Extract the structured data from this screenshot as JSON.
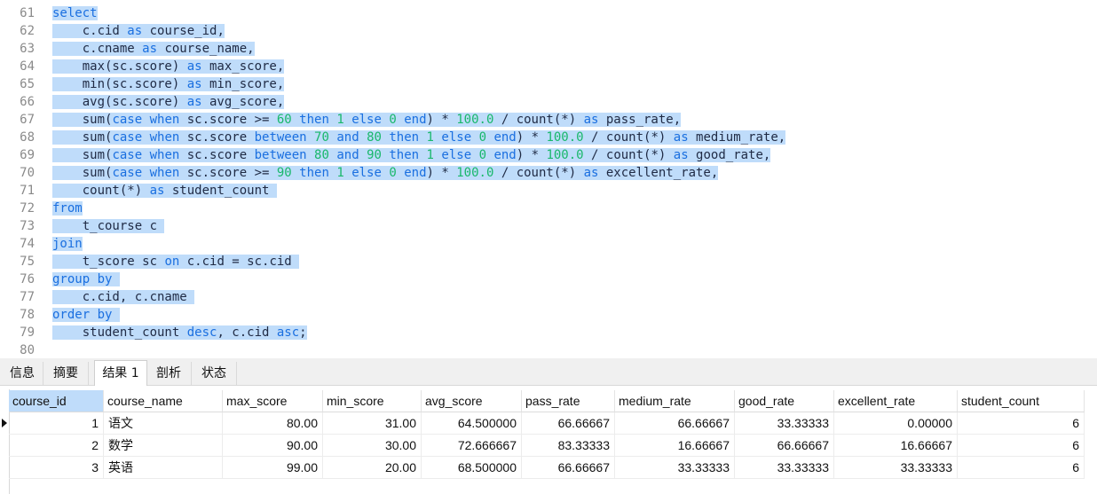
{
  "editor": {
    "lines": [
      {
        "no": "61",
        "segs": [
          {
            "t": "select",
            "c": "kw"
          }
        ]
      },
      {
        "no": "62",
        "segs": [
          {
            "t": "    c.cid "
          },
          {
            "t": "as",
            "c": "kw"
          },
          {
            "t": " course_id,"
          }
        ]
      },
      {
        "no": "63",
        "segs": [
          {
            "t": "    c.cname "
          },
          {
            "t": "as",
            "c": "kw"
          },
          {
            "t": " course_name,"
          }
        ]
      },
      {
        "no": "64",
        "segs": [
          {
            "t": "    max(sc.score) "
          },
          {
            "t": "as",
            "c": "kw"
          },
          {
            "t": " max_score,"
          }
        ]
      },
      {
        "no": "65",
        "segs": [
          {
            "t": "    min(sc.score) "
          },
          {
            "t": "as",
            "c": "kw"
          },
          {
            "t": " min_score,"
          }
        ]
      },
      {
        "no": "66",
        "segs": [
          {
            "t": "    avg(sc.score) "
          },
          {
            "t": "as",
            "c": "kw"
          },
          {
            "t": " avg_score,"
          }
        ]
      },
      {
        "no": "67",
        "segs": [
          {
            "t": "    sum("
          },
          {
            "t": "case when",
            "c": "kw"
          },
          {
            "t": " sc.score >= "
          },
          {
            "t": "60",
            "c": "num"
          },
          {
            "t": " "
          },
          {
            "t": "then",
            "c": "kw"
          },
          {
            "t": " "
          },
          {
            "t": "1",
            "c": "num"
          },
          {
            "t": " "
          },
          {
            "t": "else",
            "c": "kw"
          },
          {
            "t": " "
          },
          {
            "t": "0",
            "c": "num"
          },
          {
            "t": " "
          },
          {
            "t": "end",
            "c": "kw"
          },
          {
            "t": ") * "
          },
          {
            "t": "100.0",
            "c": "num"
          },
          {
            "t": " / count(*) "
          },
          {
            "t": "as",
            "c": "kw"
          },
          {
            "t": " pass_rate,"
          }
        ]
      },
      {
        "no": "68",
        "segs": [
          {
            "t": "    sum("
          },
          {
            "t": "case when",
            "c": "kw"
          },
          {
            "t": " sc.score "
          },
          {
            "t": "between",
            "c": "kw"
          },
          {
            "t": " "
          },
          {
            "t": "70",
            "c": "num"
          },
          {
            "t": " "
          },
          {
            "t": "and",
            "c": "kw"
          },
          {
            "t": " "
          },
          {
            "t": "80",
            "c": "num"
          },
          {
            "t": " "
          },
          {
            "t": "then",
            "c": "kw"
          },
          {
            "t": " "
          },
          {
            "t": "1",
            "c": "num"
          },
          {
            "t": " "
          },
          {
            "t": "else",
            "c": "kw"
          },
          {
            "t": " "
          },
          {
            "t": "0",
            "c": "num"
          },
          {
            "t": " "
          },
          {
            "t": "end",
            "c": "kw"
          },
          {
            "t": ") * "
          },
          {
            "t": "100.0",
            "c": "num"
          },
          {
            "t": " / count(*) "
          },
          {
            "t": "as",
            "c": "kw"
          },
          {
            "t": " medium_rate,"
          }
        ]
      },
      {
        "no": "69",
        "segs": [
          {
            "t": "    sum("
          },
          {
            "t": "case when",
            "c": "kw"
          },
          {
            "t": " sc.score "
          },
          {
            "t": "between",
            "c": "kw"
          },
          {
            "t": " "
          },
          {
            "t": "80",
            "c": "num"
          },
          {
            "t": " "
          },
          {
            "t": "and",
            "c": "kw"
          },
          {
            "t": " "
          },
          {
            "t": "90",
            "c": "num"
          },
          {
            "t": " "
          },
          {
            "t": "then",
            "c": "kw"
          },
          {
            "t": " "
          },
          {
            "t": "1",
            "c": "num"
          },
          {
            "t": " "
          },
          {
            "t": "else",
            "c": "kw"
          },
          {
            "t": " "
          },
          {
            "t": "0",
            "c": "num"
          },
          {
            "t": " "
          },
          {
            "t": "end",
            "c": "kw"
          },
          {
            "t": ") * "
          },
          {
            "t": "100.0",
            "c": "num"
          },
          {
            "t": " / count(*) "
          },
          {
            "t": "as",
            "c": "kw"
          },
          {
            "t": " good_rate,"
          }
        ]
      },
      {
        "no": "70",
        "segs": [
          {
            "t": "    sum("
          },
          {
            "t": "case when",
            "c": "kw"
          },
          {
            "t": " sc.score >= "
          },
          {
            "t": "90",
            "c": "num"
          },
          {
            "t": " "
          },
          {
            "t": "then",
            "c": "kw"
          },
          {
            "t": " "
          },
          {
            "t": "1",
            "c": "num"
          },
          {
            "t": " "
          },
          {
            "t": "else",
            "c": "kw"
          },
          {
            "t": " "
          },
          {
            "t": "0",
            "c": "num"
          },
          {
            "t": " "
          },
          {
            "t": "end",
            "c": "kw"
          },
          {
            "t": ") * "
          },
          {
            "t": "100.0",
            "c": "num"
          },
          {
            "t": " / count(*) "
          },
          {
            "t": "as",
            "c": "kw"
          },
          {
            "t": " excellent_rate,"
          }
        ]
      },
      {
        "no": "71",
        "segs": [
          {
            "t": "    count(*) "
          },
          {
            "t": "as",
            "c": "kw"
          },
          {
            "t": " student_count "
          }
        ]
      },
      {
        "no": "72",
        "segs": [
          {
            "t": "from",
            "c": "kw"
          }
        ]
      },
      {
        "no": "73",
        "segs": [
          {
            "t": "    t_course c "
          }
        ]
      },
      {
        "no": "74",
        "segs": [
          {
            "t": "join",
            "c": "kw"
          }
        ]
      },
      {
        "no": "75",
        "segs": [
          {
            "t": "    t_score sc "
          },
          {
            "t": "on",
            "c": "kw"
          },
          {
            "t": " c.cid = sc.cid "
          }
        ]
      },
      {
        "no": "76",
        "segs": [
          {
            "t": "group by",
            "c": "kw"
          },
          {
            "t": " "
          }
        ]
      },
      {
        "no": "77",
        "segs": [
          {
            "t": "    c.cid, c.cname "
          }
        ]
      },
      {
        "no": "78",
        "segs": [
          {
            "t": "order by",
            "c": "kw"
          },
          {
            "t": " "
          }
        ]
      },
      {
        "no": "79",
        "segs": [
          {
            "t": "    student_count "
          },
          {
            "t": "desc",
            "c": "kw"
          },
          {
            "t": ", c.cid "
          },
          {
            "t": "asc",
            "c": "kw"
          },
          {
            "t": ";"
          }
        ]
      },
      {
        "no": "80",
        "segs": []
      }
    ],
    "colors": {
      "keyword": "#1a6fe0",
      "number": "#19b86b",
      "selection": "#bfdcfa",
      "line_number": "#8a8a8a"
    }
  },
  "tabs": [
    {
      "label": "信息",
      "active": false
    },
    {
      "label": "摘要",
      "active": false
    },
    {
      "label": "结果 1",
      "active": true
    },
    {
      "label": "剖析",
      "active": false
    },
    {
      "label": "状态",
      "active": false
    }
  ],
  "results": {
    "columns": [
      "course_id",
      "course_name",
      "max_score",
      "min_score",
      "avg_score",
      "pass_rate",
      "medium_rate",
      "good_rate",
      "excellent_rate",
      "student_count"
    ],
    "rows": [
      [
        "1",
        "语文",
        "80.00",
        "31.00",
        "64.500000",
        "66.66667",
        "66.66667",
        "33.33333",
        "0.00000",
        "6"
      ],
      [
        "2",
        "数学",
        "90.00",
        "30.00",
        "72.666667",
        "83.33333",
        "16.66667",
        "66.66667",
        "16.66667",
        "6"
      ],
      [
        "3",
        "英语",
        "99.00",
        "20.00",
        "68.500000",
        "66.66667",
        "33.33333",
        "33.33333",
        "33.33333",
        "6"
      ]
    ]
  }
}
